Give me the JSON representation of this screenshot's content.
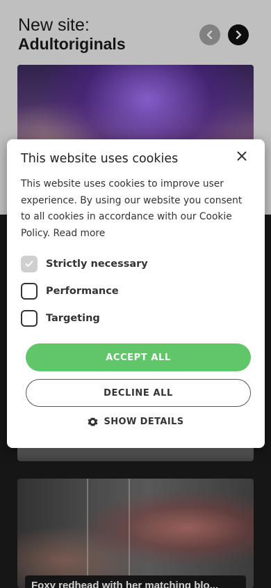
{
  "page": {
    "section_title_line1": "New site:",
    "section_title_line2": "Adultoriginals",
    "prev_icon": "chevron-left-icon",
    "next_icon": "chevron-right-icon",
    "caption_partial": "Foxy redhead with her matching blo..."
  },
  "cookie_modal": {
    "title": "This website uses cookies",
    "body": "This website uses cookies to improve user experience. By using our website you consent to all cookies in accordance with our Cookie Policy.",
    "read_more": "Read more",
    "close_icon": "close-icon",
    "options": [
      {
        "label": "Strictly necessary",
        "checked": true
      },
      {
        "label": "Performance",
        "checked": false
      },
      {
        "label": "Targeting",
        "checked": false
      }
    ],
    "accept_label": "ACCEPT ALL",
    "decline_label": "DECLINE ALL",
    "details_label": "SHOW DETAILS",
    "details_icon": "gear-icon"
  },
  "colors": {
    "accept": "#61c56a",
    "nav_prev": "#9e9e9e",
    "nav_next": "#111111"
  }
}
